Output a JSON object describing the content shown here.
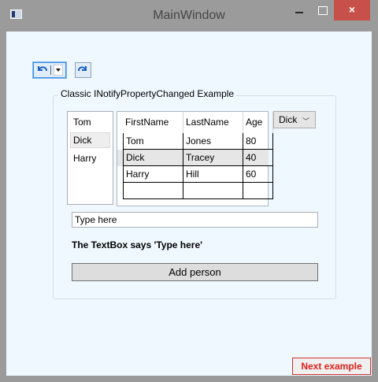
{
  "window": {
    "title": "MainWindow",
    "close_glyph": "×",
    "colors": {
      "titlebar": "#9b9b9b",
      "close": "#c7504a",
      "client": "#f0f8ff"
    }
  },
  "toolbar": {
    "undo_icon": "undo-icon",
    "redo_icon": "redo-icon"
  },
  "group": {
    "label": "Classic INotifyPropertyChanged Example",
    "list_items": [
      {
        "label": "Tom",
        "selected": false
      },
      {
        "label": "Dick",
        "selected": true
      },
      {
        "label": "Harry",
        "selected": false
      }
    ],
    "grid": {
      "columns": [
        "FirstName",
        "LastName",
        "Age"
      ],
      "rows": [
        {
          "first": "Tom",
          "last": "Jones",
          "age": "80",
          "selected": false
        },
        {
          "first": "Dick",
          "last": "Tracey",
          "age": "40",
          "selected": true
        },
        {
          "first": "Harry",
          "last": "Hill",
          "age": "60",
          "selected": false
        }
      ]
    },
    "combo": {
      "selected": "Dick",
      "chevron": "﹀"
    },
    "textbox": {
      "value": "Type here"
    },
    "says_text": "The TextBox says 'Type here'",
    "add_button": "Add person"
  },
  "next_button": "Next example"
}
